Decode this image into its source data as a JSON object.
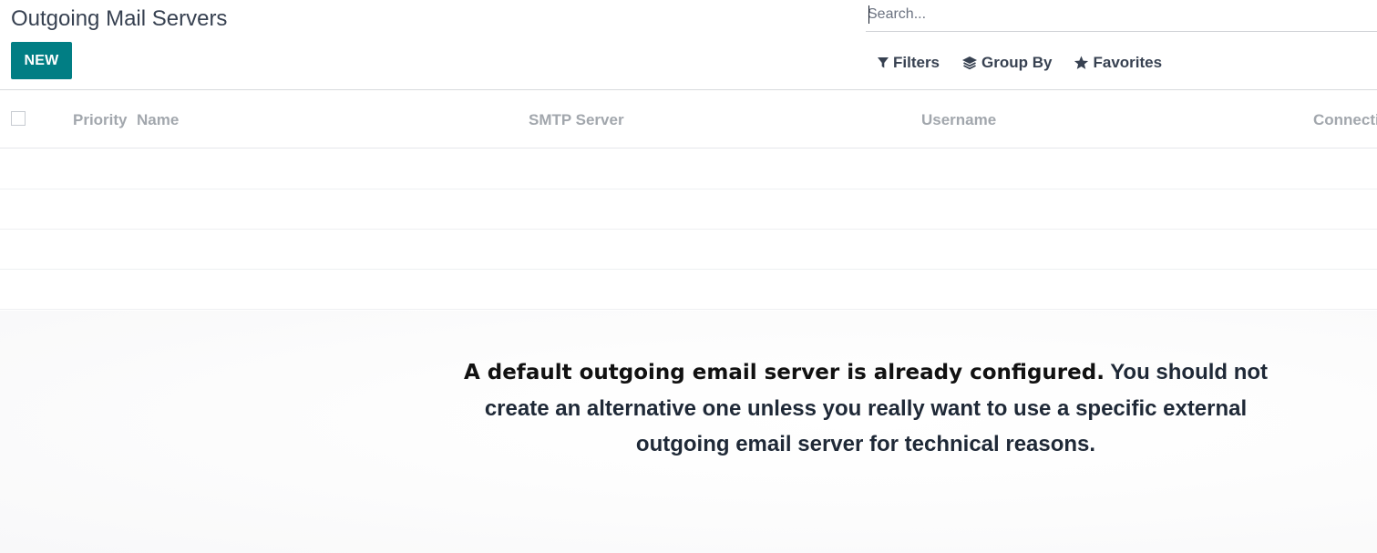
{
  "page": {
    "title": "Outgoing Mail Servers"
  },
  "actions": {
    "new_label": "NEW"
  },
  "search": {
    "placeholder": "Search...",
    "value": ""
  },
  "search_tools": {
    "filters_label": "Filters",
    "group_by_label": "Group By",
    "favorites_label": "Favorites"
  },
  "list": {
    "columns": [
      "Priority",
      "Name",
      "SMTP Server",
      "Username",
      "Connecti"
    ],
    "row_count": 0
  },
  "help": {
    "lead": "A default outgoing email server is already configured.",
    "body": " You should not create an alternative one unless you really want to use a specific external outgoing email server for technical reasons."
  },
  "colors": {
    "primary": "#017e84",
    "header_text": "#a2a7ad",
    "text": "#374151"
  },
  "icons": {
    "filters": "filter-icon",
    "group_by": "layers-icon",
    "favorites": "star-icon"
  }
}
